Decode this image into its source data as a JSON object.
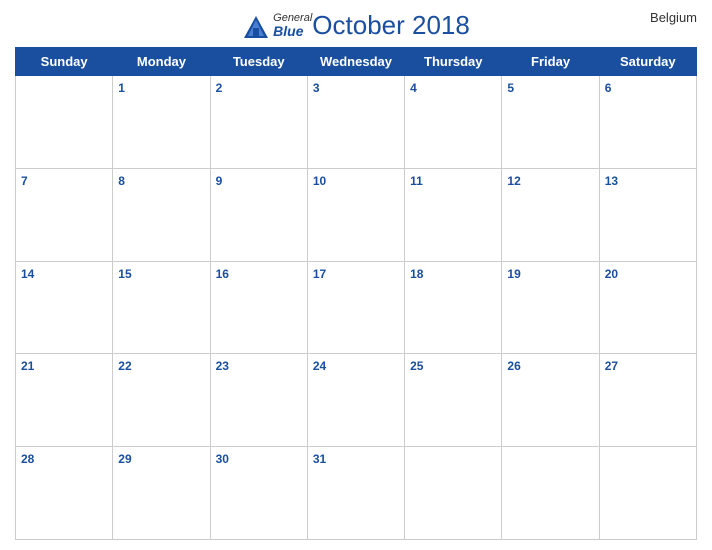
{
  "header": {
    "title": "October 2018",
    "country": "Belgium",
    "logo_general": "General",
    "logo_blue": "Blue"
  },
  "weekdays": [
    "Sunday",
    "Monday",
    "Tuesday",
    "Wednesday",
    "Thursday",
    "Friday",
    "Saturday"
  ],
  "weeks": [
    [
      null,
      1,
      2,
      3,
      4,
      5,
      6
    ],
    [
      7,
      8,
      9,
      10,
      11,
      12,
      13
    ],
    [
      14,
      15,
      16,
      17,
      18,
      19,
      20
    ],
    [
      21,
      22,
      23,
      24,
      25,
      26,
      27
    ],
    [
      28,
      29,
      30,
      31,
      null,
      null,
      null
    ]
  ],
  "colors": {
    "header_bg": "#1a4fa0",
    "header_text": "#ffffff",
    "day_number": "#1a4fa0",
    "title": "#1a4fa0"
  }
}
